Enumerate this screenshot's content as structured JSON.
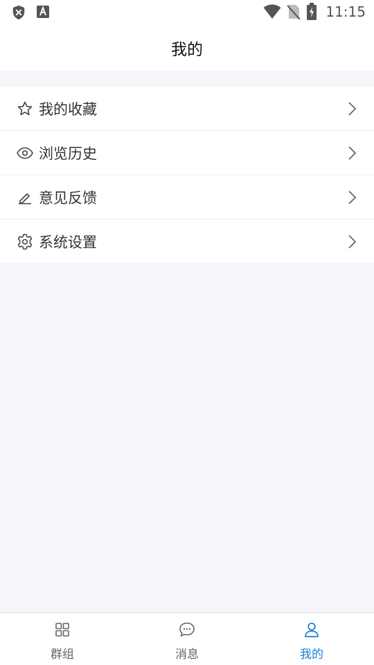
{
  "status_bar": {
    "time": "11:15",
    "left_icons": [
      "shield-x-icon",
      "font-a-icon"
    ],
    "right_icons": [
      "wifi-icon",
      "no-sim-icon",
      "battery-charging-icon"
    ]
  },
  "header": {
    "title": "我的"
  },
  "menu": {
    "items": [
      {
        "label": "我的收藏",
        "icon": "star-icon"
      },
      {
        "label": "浏览历史",
        "icon": "eye-icon"
      },
      {
        "label": "意见反馈",
        "icon": "pencil-icon"
      },
      {
        "label": "系统设置",
        "icon": "gear-icon"
      }
    ]
  },
  "tabbar": {
    "tabs": [
      {
        "label": "群组",
        "icon": "grid-icon",
        "active": false
      },
      {
        "label": "消息",
        "icon": "chat-bubble-icon",
        "active": false
      },
      {
        "label": "我的",
        "icon": "user-icon",
        "active": true
      }
    ]
  },
  "colors": {
    "active": "#1a7fd4",
    "inactive": "#666666",
    "background": "#f5f5fa",
    "icon": "#444444"
  }
}
